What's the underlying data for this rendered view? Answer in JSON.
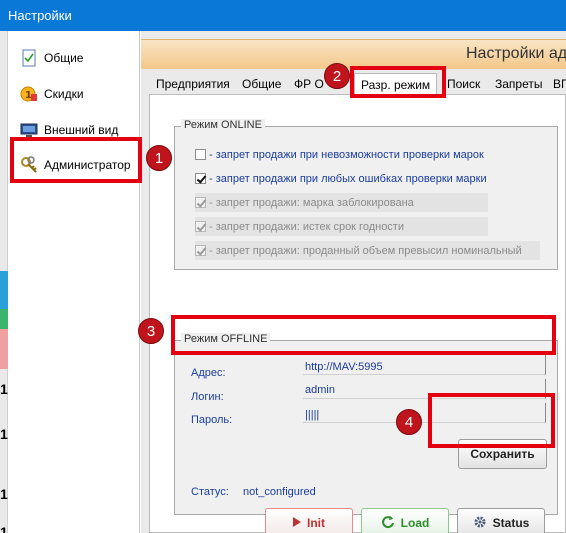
{
  "window": {
    "title": "Настройки"
  },
  "header": {
    "title": "Настройки ад"
  },
  "sidebar": {
    "items": [
      {
        "label": "Общие",
        "icon": "document-icon"
      },
      {
        "label": "Скидки",
        "icon": "discount-icon"
      },
      {
        "label": "Внешний вид",
        "icon": "monitor-icon"
      },
      {
        "label": "Администратор",
        "icon": "keys-icon",
        "active": true
      }
    ]
  },
  "tabs": [
    {
      "label": "Предприятия"
    },
    {
      "label": "Общие"
    },
    {
      "label": "ФР О"
    },
    {
      "label": "Разр. режим",
      "active": true
    },
    {
      "label": "Поиск"
    },
    {
      "label": "Запреты"
    },
    {
      "label": "ВП"
    }
  ],
  "online": {
    "legend": "Режим ONLINE",
    "options": [
      {
        "label": "- запрет продажи при невозможности проверки марок",
        "checked": false,
        "enabled": true
      },
      {
        "label": "- запрет продажи при любых ошибках проверки марки",
        "checked": true,
        "enabled": true
      },
      {
        "label": "- запрет продажи: марка заблокирована",
        "checked": true,
        "enabled": false
      },
      {
        "label": "- запрет продажи: истек срок годности",
        "checked": true,
        "enabled": false
      },
      {
        "label": "- запрет продажи: проданный объем превысил номинальный",
        "checked": true,
        "enabled": false
      }
    ]
  },
  "offline": {
    "legend": "Режим OFFLINE",
    "address_label": "Адрес:",
    "address_value": "http://MAV:5995",
    "login_label": "Логин:",
    "login_value": "admin",
    "password_label": "Пароль:",
    "password_value": "|||||",
    "save_label": "Сохранить",
    "status_label": "Статус:",
    "status_value": "not_configured",
    "init_label": "Init",
    "load_label": "Load",
    "status_button_label": "Status"
  },
  "left_strip_digits": [
    "1",
    "1",
    "1",
    "1"
  ],
  "annotations": {
    "badges": [
      "1",
      "2",
      "3",
      "4"
    ],
    "color": "#e3000f"
  },
  "colors": {
    "titlebar": "#0a78d7",
    "label_blue": "#1a3c9c",
    "header_orange": "#f3c88a"
  }
}
